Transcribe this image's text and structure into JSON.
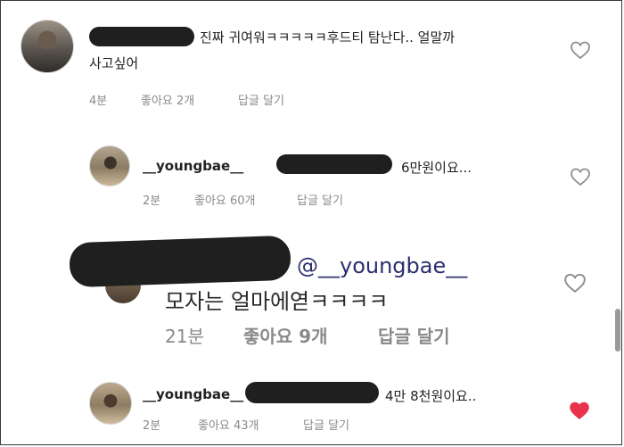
{
  "comments": [
    {
      "text_line1": "진짜 귀여워ㅋㅋㅋㅋㅋ후드티 탐난다.. 얼말까",
      "text_line2": "사고싶어",
      "time": "4분",
      "likes": "좋아요 2개",
      "reply": "답글 달기",
      "liked": false
    },
    {
      "username": "__youngbae__",
      "text": "6만원이요...",
      "time": "2분",
      "likes": "좋아요 60개",
      "reply": "답글 달기",
      "liked": false
    },
    {
      "mention": "@__youngbae__",
      "text": "모자는 얼마에엳ㅋㅋㅋㅋ",
      "time": "21분",
      "likes": "좋아요 9개",
      "reply": "답글 달기",
      "liked": false
    },
    {
      "username": "__youngbae__",
      "text": "4만 8천원이요..",
      "time": "2분",
      "likes": "좋아요 43개",
      "reply": "답글 달기",
      "liked": true
    }
  ],
  "icons": {
    "like": "heart-icon",
    "liked": "heart-filled-icon"
  },
  "colors": {
    "liked_heart": "#e8334a",
    "heart_outline": "#8e8e8e",
    "mention": "#2b2f6e"
  }
}
